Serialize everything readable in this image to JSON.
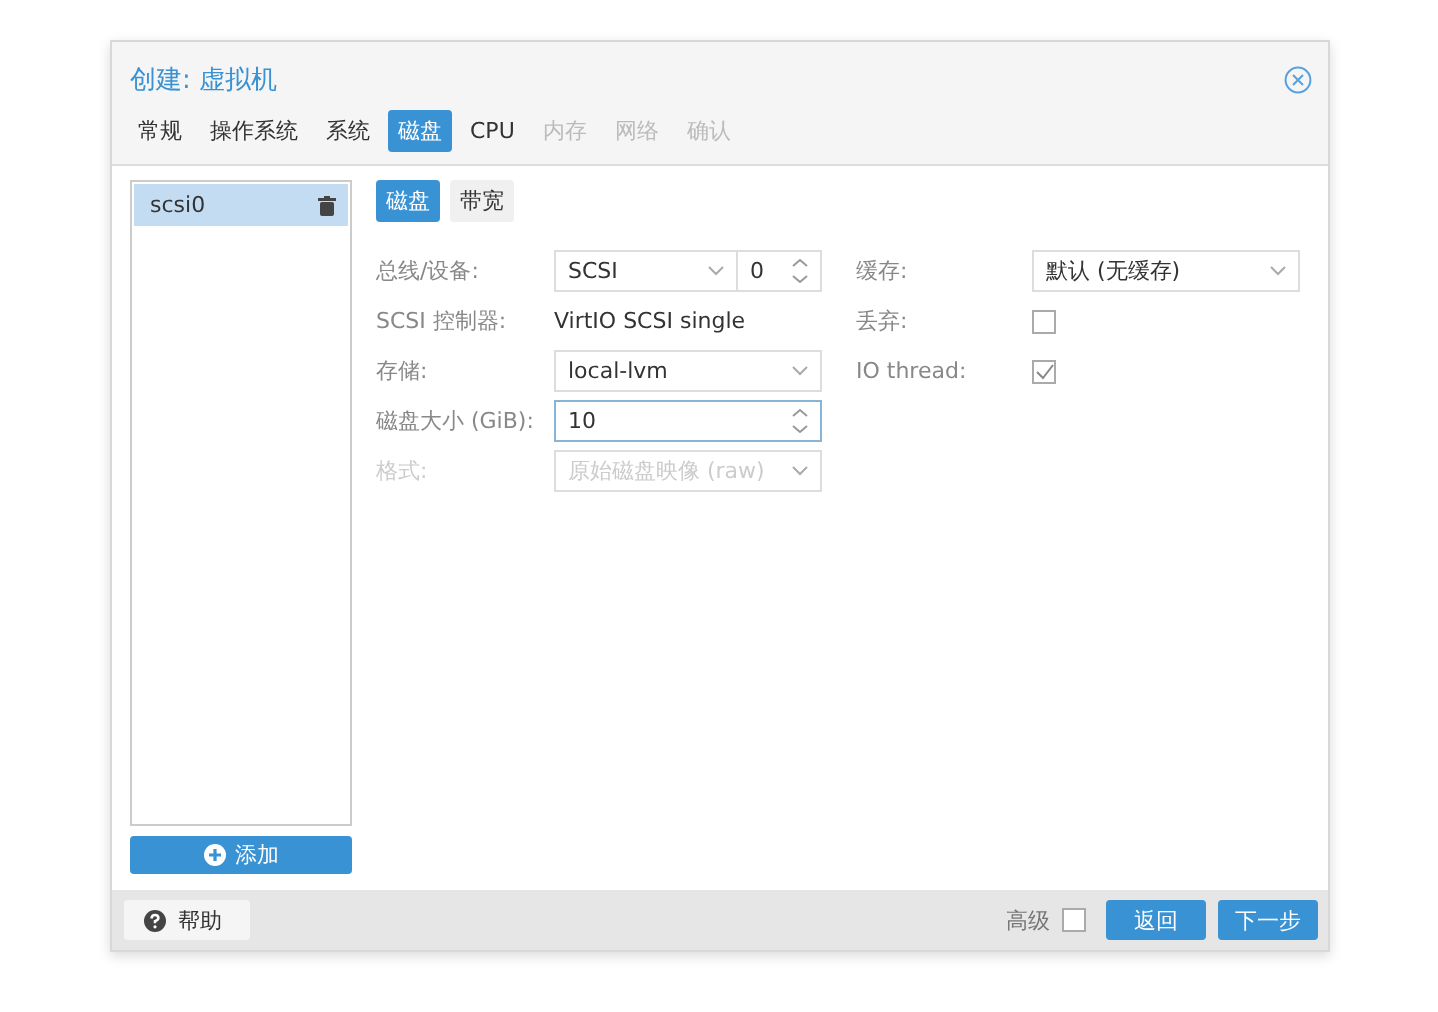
{
  "window": {
    "title": "创建: 虚拟机"
  },
  "tabs": [
    {
      "label": "常规",
      "selected": false,
      "disabled": false
    },
    {
      "label": "操作系统",
      "selected": false,
      "disabled": false
    },
    {
      "label": "系统",
      "selected": false,
      "disabled": false
    },
    {
      "label": "磁盘",
      "selected": true,
      "disabled": false
    },
    {
      "label": "CPU",
      "selected": false,
      "disabled": false
    },
    {
      "label": "内存",
      "selected": false,
      "disabled": true
    },
    {
      "label": "网络",
      "selected": false,
      "disabled": true
    },
    {
      "label": "确认",
      "selected": false,
      "disabled": true
    }
  ],
  "disks": [
    {
      "label": "scsi0",
      "selected": true
    }
  ],
  "add_button": "添加",
  "subtabs": [
    {
      "label": "磁盘",
      "selected": true
    },
    {
      "label": "带宽",
      "selected": false
    }
  ],
  "left_fields": [
    {
      "kind": "combo",
      "label": "总线/设备:",
      "value": "SCSI",
      "value2": "0",
      "disabled": false
    },
    {
      "kind": "display",
      "label": "SCSI 控制器:",
      "value": "VirtIO SCSI single",
      "disabled": false
    },
    {
      "kind": "select",
      "label": "存储:",
      "value": "local-lvm",
      "disabled": false
    },
    {
      "kind": "number",
      "label": "磁盘大小 (GiB):",
      "value": "10",
      "disabled": false,
      "focused": true
    },
    {
      "kind": "select",
      "label": "格式:",
      "value": "原始磁盘映像 (raw)",
      "disabled": true
    }
  ],
  "right_fields": [
    {
      "kind": "select",
      "label": "缓存:",
      "value": "默认 (无缓存)"
    },
    {
      "kind": "checkbox",
      "label": "丢弃:",
      "checked": false
    },
    {
      "kind": "checkbox",
      "label": "IO thread:",
      "checked": true
    }
  ],
  "footer": {
    "help": "帮助",
    "advanced": {
      "label": "高级",
      "checked": false
    },
    "back": "返回",
    "next": "下一步"
  }
}
